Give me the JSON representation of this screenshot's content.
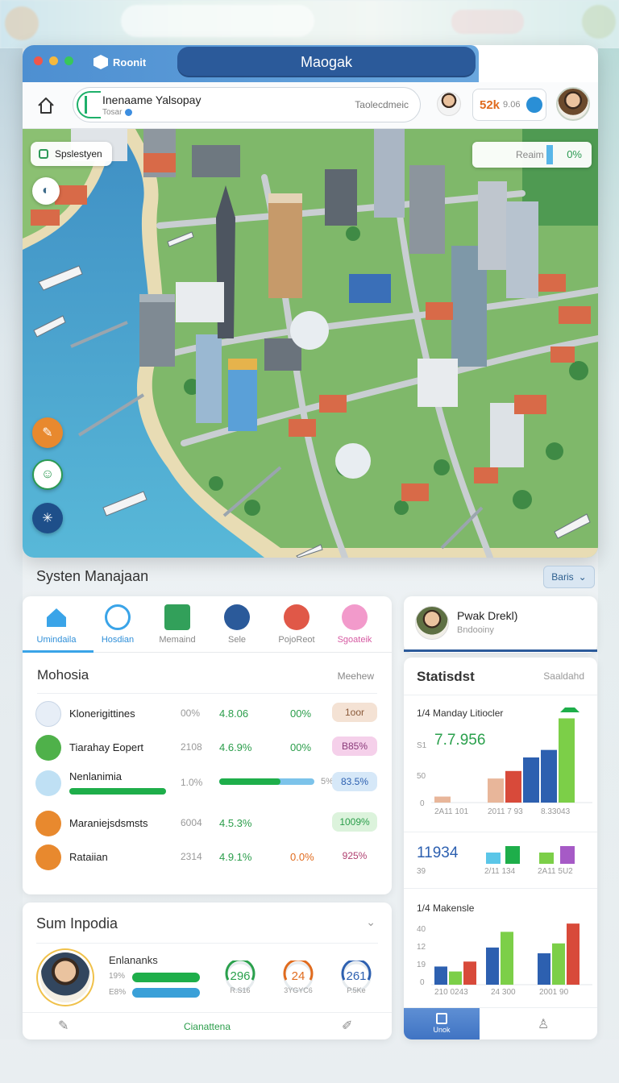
{
  "window": {
    "app_name": "Roonit",
    "title": "Maogak"
  },
  "toolbar": {
    "profile_name": "Inenaame Yalsopay",
    "profile_sub": "Tosar",
    "profile_right": "Taolecdmeic",
    "coins_value": "52k",
    "coins_sub": "9.06"
  },
  "map": {
    "chip_label": "Spslestyen",
    "search_placeholder": "Reaim",
    "search_pct": "0%"
  },
  "section": {
    "title": "Systen Manajaan",
    "dropdown": "Baris"
  },
  "tabs": [
    {
      "label": "Umindaila",
      "icon": "home-icon",
      "color": "#3aa4e8"
    },
    {
      "label": "Hosdian",
      "icon": "check-circle-icon",
      "color": "#3aa4e8"
    },
    {
      "label": "Memaind",
      "icon": "map-icon",
      "color": "#32a05a"
    },
    {
      "label": "Sele",
      "icon": "monitor-icon",
      "color": "#2b5a9a"
    },
    {
      "label": "PojoReot",
      "icon": "target-icon",
      "color": "#e05848"
    },
    {
      "label": "Sgoateik",
      "icon": "badge-icon",
      "color": "#f29acb"
    }
  ],
  "table": {
    "heading": "Mohosia",
    "right_label": "Meehew",
    "rows": [
      {
        "name": "Klonerigittines",
        "c1": "00%",
        "c2": "4.8.06",
        "c3": "00%",
        "c4": "1oor",
        "icon": "device-icon",
        "badge_bg": "#f4e2d4",
        "badge_fg": "#8a5a3a"
      },
      {
        "name": "Tiarahay Eopert",
        "c1": "2108",
        "c2": "4.6.9%",
        "c3": "00%",
        "c4": "B85%",
        "icon": "handshake-icon",
        "badge_bg": "#f5d0ea",
        "badge_fg": "#8a3a7a"
      },
      {
        "name": "Nenlanimia",
        "c1": "1.0%",
        "c2": "",
        "c3": "5%",
        "c4": "83.5%",
        "icon": "bug-icon",
        "badge_bg": "#d6e8f8",
        "badge_fg": "#2d60b0"
      },
      {
        "name": "Maraniejsdsmsts",
        "c1": "6004",
        "c2": "4.5.3%",
        "c3": "",
        "c4": "1009%",
        "icon": "briefcase-icon",
        "badge_bg": "#dcf3dc",
        "badge_fg": "#2a9d4a"
      },
      {
        "name": "Rataiian",
        "c1": "2314",
        "c2": "4.9.1%",
        "c3": "0.0%",
        "c4": "925%",
        "icon": "cookie-icon",
        "badge_bg": "#ffffff",
        "badge_fg": "#b04070"
      }
    ]
  },
  "profile": {
    "title": "Sum Inpodia",
    "name": "Enlananks",
    "r1": "19%",
    "r2": "E8%",
    "gauges": [
      {
        "value": "296",
        "label": "R.S16",
        "color": "#2aa04c"
      },
      {
        "value": "24",
        "label": "3YGYC6",
        "color": "#e06b1e"
      },
      {
        "value": "261",
        "label": "P.5Ke",
        "color": "#2d60b0"
      }
    ],
    "footer_label": "Cianattena"
  },
  "user": {
    "name": "Pwak Drekl)",
    "sub": "Bndooiny"
  },
  "stats": {
    "title": "Statisdst",
    "right": "Saaldahd",
    "sub1": "1/4 Manday Litiocler",
    "big1": "7.7.956",
    "big2": "11934",
    "sub2": "1/4 Makensle",
    "nav_label": "Unok",
    "axis1": [
      "S1",
      "50",
      "0"
    ],
    "xlabels1": [
      "2A11 101",
      "2011 7 93",
      "8.33043"
    ],
    "axis2": [
      "39"
    ],
    "xlabels2": [
      "2/11 134",
      "2A11 5U2"
    ],
    "axis3": [
      "40",
      "12",
      "19",
      "0"
    ],
    "xlabels3": [
      "210 0243",
      "24 300",
      "2001 90"
    ]
  },
  "chart_data": [
    {
      "type": "bar",
      "title": "1/4 Manday Litiocler",
      "categories": [
        "2A11 101",
        "2011 7 93",
        "8.33043"
      ],
      "series": [
        {
          "values": [
            8,
            32,
            0
          ]
        },
        {
          "values": [
            0,
            42,
            0
          ]
        },
        {
          "values": [
            0,
            60,
            70
          ]
        },
        {
          "values": [
            0,
            0,
            112
          ]
        }
      ]
    },
    {
      "type": "bar",
      "title": "1/4 Makensle",
      "categories": [
        "210 0243",
        "24 300",
        "2001 90"
      ],
      "series": [
        {
          "values": [
            22,
            45,
            38
          ]
        },
        {
          "values": [
            16,
            64,
            50
          ]
        },
        {
          "values": [
            28,
            0,
            74
          ]
        }
      ]
    }
  ]
}
